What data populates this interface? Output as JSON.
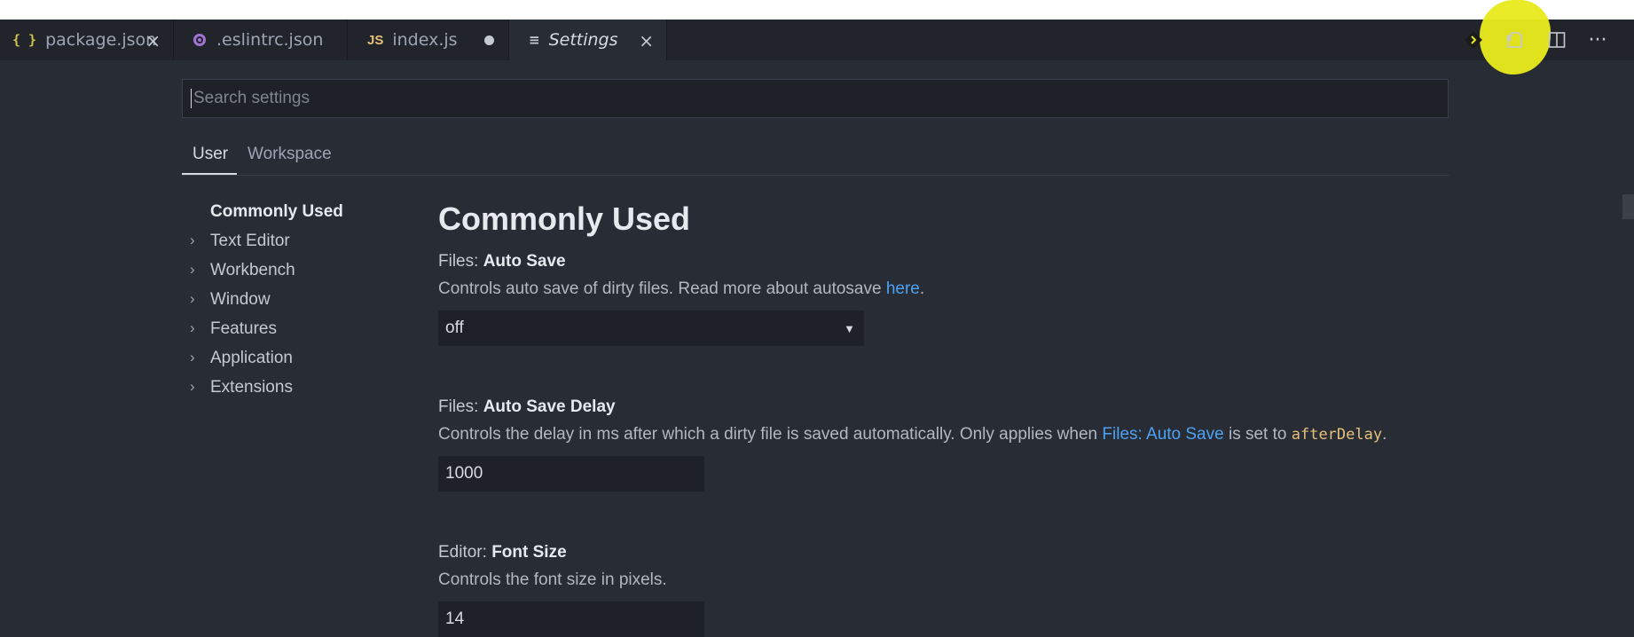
{
  "tabs": [
    {
      "label": "package.json",
      "icon": "json-icon",
      "icon_text": "{ }",
      "close": "×"
    },
    {
      "label": ".eslintrc.json",
      "icon": "eslint-icon"
    },
    {
      "label": "index.js",
      "icon": "js-icon",
      "icon_text": "JS",
      "dirty": true
    },
    {
      "label": "Settings",
      "icon": "settings-icon",
      "icon_text": "≡",
      "close": "×",
      "active": true
    }
  ],
  "actions": [
    "git-compare-icon",
    "open-file-icon",
    "split-editor-icon",
    "more-icon"
  ],
  "actions_glyphs": {
    "more": "···"
  },
  "search": {
    "placeholder": "Search settings"
  },
  "scopes": [
    "User",
    "Workspace"
  ],
  "toc": {
    "items": [
      "Commonly Used",
      "Text Editor",
      "Workbench",
      "Window",
      "Features",
      "Application",
      "Extensions"
    ],
    "chevron": "›"
  },
  "content": {
    "section_title": "Commonly Used",
    "settings": [
      {
        "category": "Files:",
        "name": "Auto Save",
        "description": "Controls auto save of dirty files. Read more about autosave",
        "link": "here",
        "suffix": ".",
        "control": "select",
        "value": "off",
        "arrow": "▼"
      },
      {
        "category": "Files:",
        "name": "Auto Save Delay",
        "description": "Controls the delay in ms after which a dirty file is saved automatically. Only applies when",
        "link": "Files: Auto Save",
        "middle": "is set to",
        "code": "afterDelay",
        "suffix": ".",
        "control": "input",
        "value": "1000"
      },
      {
        "category": "Editor:",
        "name": "Font Size",
        "description": "Controls the font size in pixels.",
        "control": "input",
        "value": "14"
      }
    ]
  },
  "colors": {
    "background": "#282c34",
    "tab_bar": "#21252b",
    "link": "#4ea1f3",
    "code": "#e5c07b",
    "highlight": "#e7ea1c"
  }
}
